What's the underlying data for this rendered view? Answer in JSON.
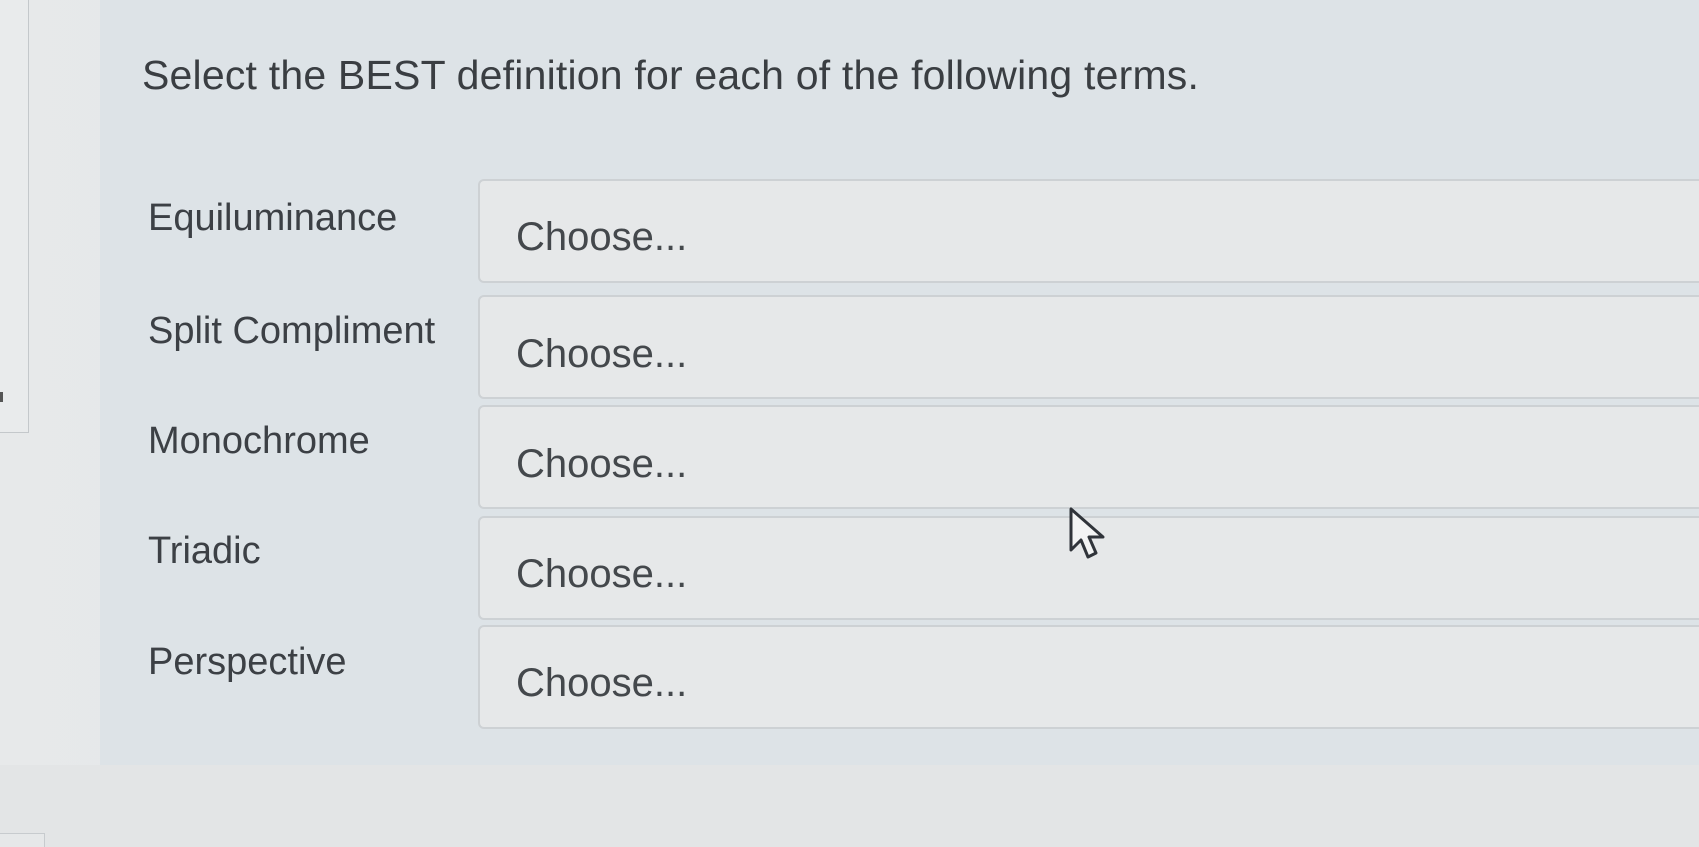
{
  "question": {
    "prompt": "Select the BEST definition for each of the following terms."
  },
  "matching": [
    {
      "term": "Equiluminance",
      "selected": "Choose..."
    },
    {
      "term": "Split Compliment",
      "selected": "Choose..."
    },
    {
      "term": "Monochrome",
      "selected": "Choose..."
    },
    {
      "term": "Triadic",
      "selected": "Choose..."
    },
    {
      "term": "Perspective",
      "selected": "Choose..."
    }
  ],
  "icons": {
    "cursor": "mouse-pointer-icon"
  },
  "colors": {
    "panel_background": "#dde3e7",
    "select_background": "#e6e8e9",
    "select_border": "#cdd1d4",
    "text": "#3a3e42"
  }
}
